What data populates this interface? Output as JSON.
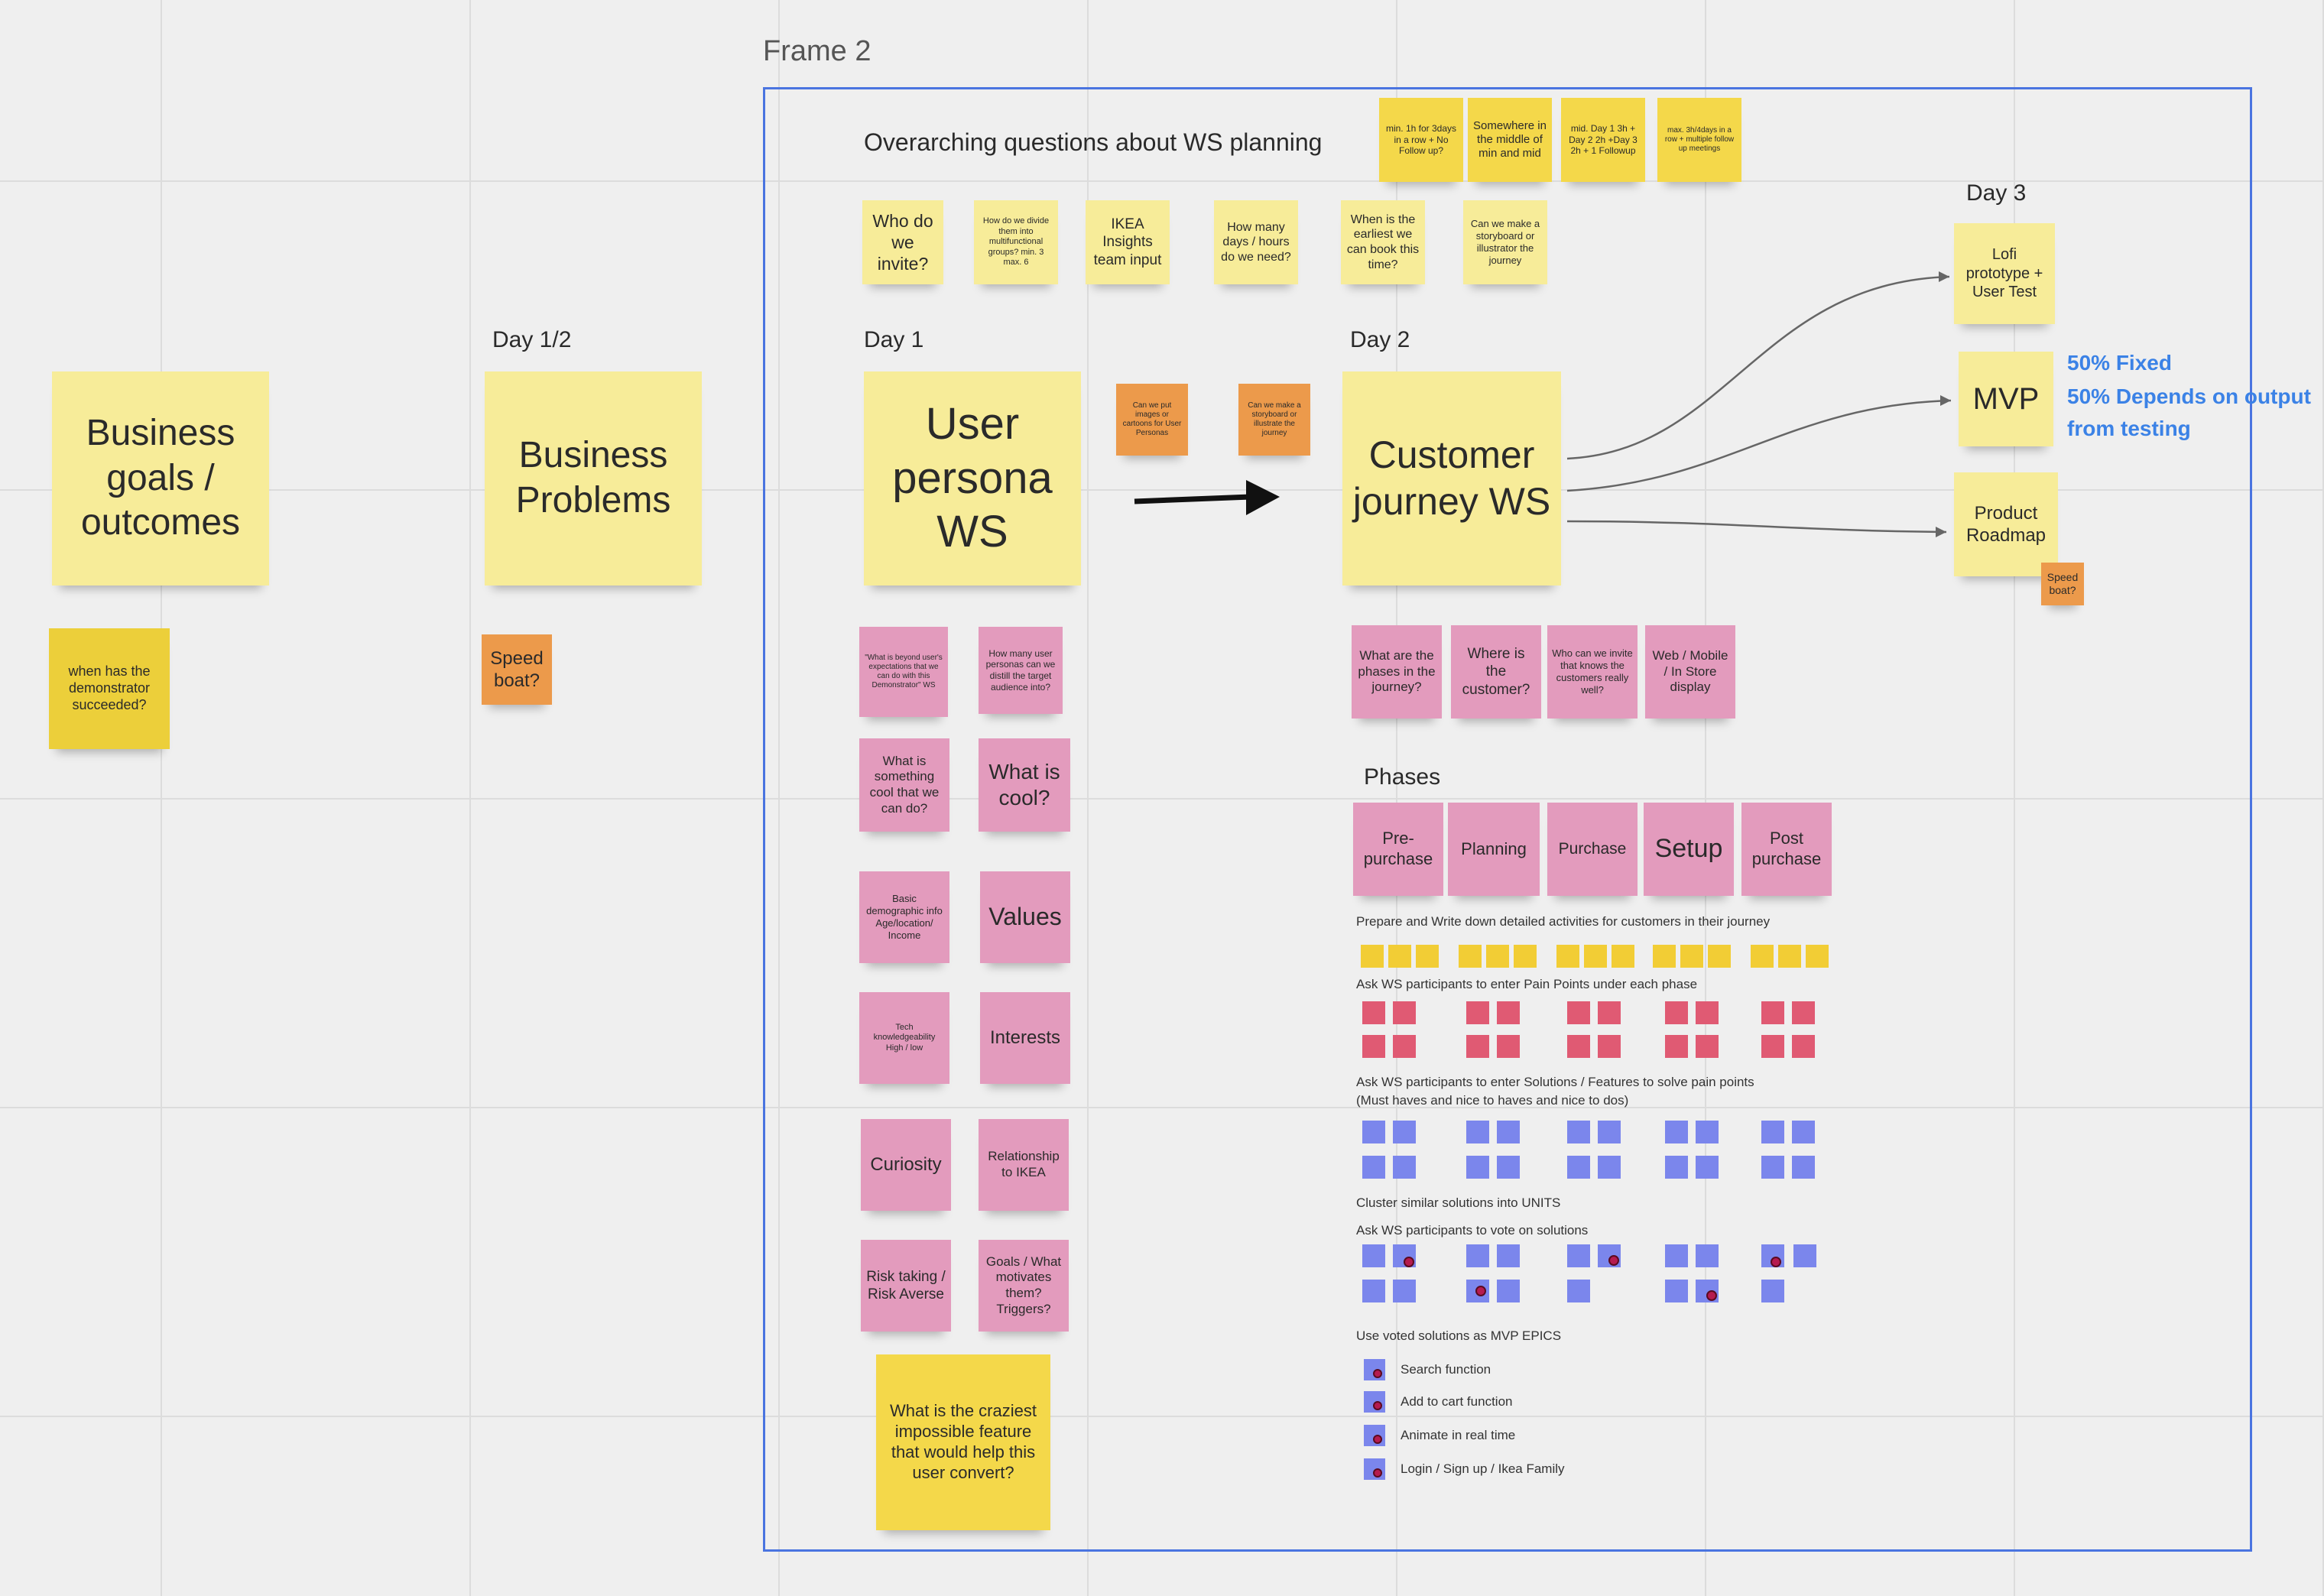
{
  "board": {
    "frame_title": "Frame 2",
    "section_labels": {
      "overarching": "Overarching questions about WS planning",
      "day_1_2": "Day 1/2",
      "day_1": "Day 1",
      "day_2": "Day 2",
      "day_3": "Day 3",
      "phases": "Phases"
    },
    "outside_notes": {
      "business_goals": "Business goals / outcomes",
      "demonstrator": "when has the demonstrator succeeded?",
      "business_problems": "Business Problems",
      "speed_boat_left": "Speed boat?"
    },
    "top_yellow_notes": {
      "min": "min. 1h for 3days in a row + No Follow up?",
      "somewhere": "Somewhere in the middle of min and mid",
      "mid": "mid. Day 1 3h + Day 2 2h +Day 3 2h + 1 Followup",
      "max": "max. 3h/4days in a row + multiple follow up meetings"
    },
    "question_notes": {
      "who": "Who do we invite?",
      "divide": "How do we divide them into multifunctional groups? min. 3 max. 6",
      "ikea_insights": "IKEA Insights team input",
      "how_many_days": "How many days / hours do we need?",
      "earliest": "When is the earliest we can book this time?",
      "storyboard": "Can we make a storyboard or illustrator the journey"
    },
    "day1": {
      "main": "User persona WS",
      "orange_images": "Can we put images or cartoons for User Personas",
      "orange_storyboard": "Can we make a storyboard or illustrate the journey",
      "pink": {
        "expectations": "\"What is beyond user's expectations that we can do with this Demonstrator\" WS",
        "how_many_personas": "How many user personas can we distill the target audience into?",
        "something_cool": "What is something cool that we can do?",
        "what_is_cool": "What is cool?",
        "demographic": "Basic demographic info Age/location/ Income",
        "values": "Values",
        "tech": "Tech knowledgeability High / low",
        "interests": "Interests",
        "curiosity": "Curiosity",
        "relationship": "Relationship to IKEA",
        "risk": "Risk taking / Risk Averse",
        "goals": "Goals / What motivates them? Triggers?"
      },
      "craziest": "What is the craziest impossible feature that would help this user convert?"
    },
    "day2": {
      "main": "Customer journey WS",
      "pink": {
        "phases_q": "What are the phases in the journey?",
        "where": "Where is the customer?",
        "who_invite": "Who can we invite that knows the customers really well?",
        "channels": "Web / Mobile / In Store display"
      },
      "phases": [
        "Pre-purchase",
        "Planning",
        "Purchase",
        "Setup",
        "Post purchase"
      ],
      "instructions": {
        "prepare": "Prepare and Write down detailed activities for customers in their journey",
        "pain": "Ask WS participants to enter Pain Points under each phase",
        "solutions_1": "Ask WS participants to enter Solutions / Features to solve pain points",
        "solutions_2": "(Must haves and nice to haves and nice to dos)",
        "cluster": "Cluster similar solutions into UNITS",
        "vote": "Ask WS participants to vote on solutions",
        "use_voted": "Use voted solutions as MVP EPICS"
      },
      "epics": [
        "Search function",
        "Add to cart function",
        "Animate in real time",
        "Login / Sign up / Ikea Family"
      ]
    },
    "day3": {
      "lofi": "Lofi prototype + User Test",
      "mvp": "MVP",
      "roadmap": "Product Roadmap",
      "speed_boat": "Speed boat?",
      "fixed": "50% Fixed",
      "depends": "50% Depends on output from testing"
    },
    "colors": {
      "frame_border": "#4a74e0",
      "light_yellow_note": "#f7ec99",
      "yellow_note": "#f4d84a",
      "orange_note": "#ec9a4b",
      "pink_note": "#e39bbd",
      "pain_point": "#e05a73",
      "solution": "#7b86ec",
      "vote_dot": "#b51b4f",
      "blue_text": "#3b82e6"
    }
  }
}
